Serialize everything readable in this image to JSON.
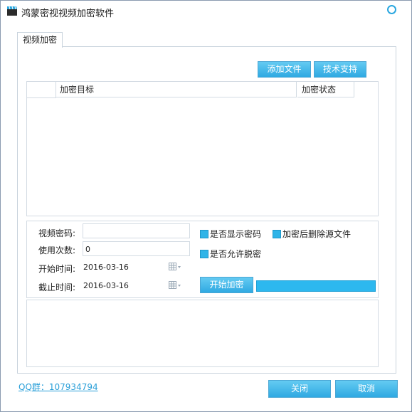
{
  "window": {
    "title": "鸿蒙密视视频加密软件"
  },
  "tabs": [
    {
      "label": "视频加密"
    }
  ],
  "toolbar": {
    "add_file_label": "添加文件",
    "support_label": "技术支持"
  },
  "file_table": {
    "columns": [
      "",
      "加密目标",
      "加密状态"
    ],
    "rows": []
  },
  "settings": {
    "password_label": "视频密码:",
    "password_value": "",
    "use_count_label": "使用次数:",
    "use_count_value": "0",
    "start_time_label": "开始时间:",
    "start_time_value": "2016-03-16",
    "end_time_label": "截止时间:",
    "end_time_value": "2016-03-16",
    "show_password_label": "是否显示密码",
    "delete_source_label": "加密后删除源文件",
    "allow_decrypt_label": "是否允许脱密",
    "start_button_label": "开始加密",
    "progress": 1.0
  },
  "footer": {
    "qq_group_text": "QQ群：107934794",
    "close_label": "关闭",
    "cancel_label": "取消"
  },
  "colors": {
    "accent": "#2fb4e8",
    "button": "#3fb3e8",
    "border": "#d3dbe3"
  }
}
